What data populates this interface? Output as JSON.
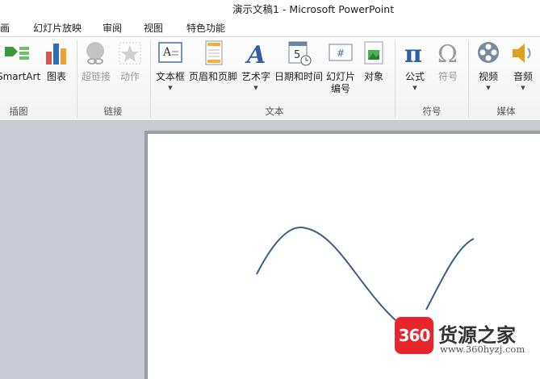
{
  "window": {
    "title": "演示文稿1  -  Microsoft PowerPoint"
  },
  "tabs": [
    "动画",
    "幻灯片放映",
    "审阅",
    "视图",
    "特色功能"
  ],
  "ribbon": {
    "groups": {
      "illustrations": "插图",
      "links": "链接",
      "text": "文本",
      "symbols": "符号",
      "media": "媒体"
    },
    "buttons": {
      "smartart": "SmartArt",
      "chart": "图表",
      "hyperlink": "超链接",
      "action": "动作",
      "textbox": "文本框",
      "header_footer": "页眉和页脚",
      "wordart": "艺术字",
      "datetime": "日期和时间",
      "slide_number_line1": "幻灯片",
      "slide_number_line2": "编号",
      "object": "对象",
      "equation": "公式",
      "symbol": "符号",
      "video": "视频",
      "audio": "音频"
    },
    "icon_names": {
      "datetime_icon_digit": "5",
      "slide_number_icon_glyph": "#",
      "equation_glyph": "π",
      "symbol_glyph": "Ω"
    }
  },
  "watermark": {
    "badge": "360",
    "text": "货源之家",
    "url": "www.360hyzj.com"
  },
  "colors": {
    "curve": "#3e5d86",
    "badge": "#e8242c",
    "workspace": "#c8ccd2"
  }
}
